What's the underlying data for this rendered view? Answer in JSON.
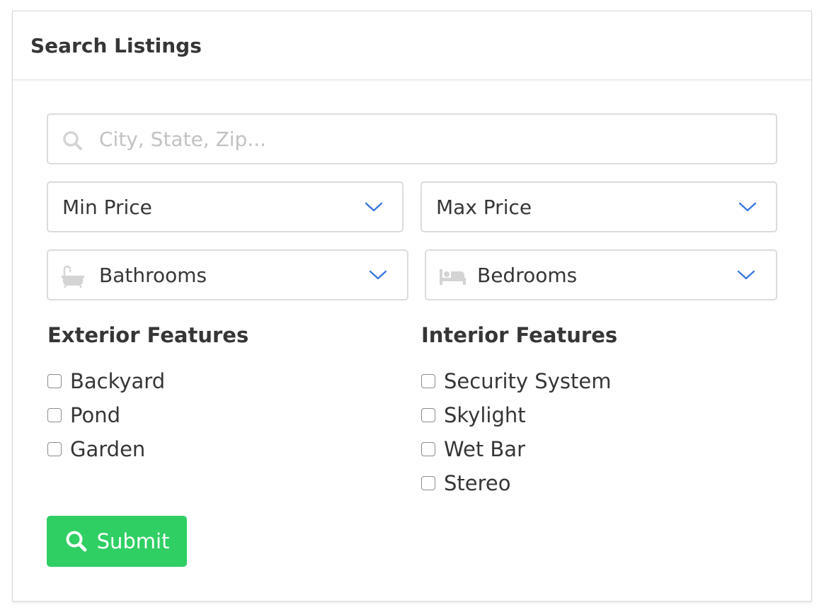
{
  "header": {
    "title": "Search Listings"
  },
  "search": {
    "placeholder": "City, State, Zip...",
    "icon": "search-icon"
  },
  "filters": {
    "min_price": "Min Price",
    "max_price": "Max Price",
    "bathrooms": "Bathrooms",
    "bedrooms": "Bedrooms",
    "bathrooms_icon": "bathtub-icon",
    "bedrooms_icon": "bed-icon",
    "chevron_color": "#3273dc"
  },
  "exterior": {
    "title": "Exterior Features",
    "items": [
      {
        "label": "Backyard",
        "checked": false
      },
      {
        "label": "Pond",
        "checked": false
      },
      {
        "label": "Garden",
        "checked": false
      }
    ]
  },
  "interior": {
    "title": "Interior Features",
    "items": [
      {
        "label": "Security System",
        "checked": false
      },
      {
        "label": "Skylight",
        "checked": false
      },
      {
        "label": "Wet Bar",
        "checked": false
      },
      {
        "label": "Stereo",
        "checked": false
      }
    ]
  },
  "submit": {
    "label": "Submit",
    "color": "#2fcf64",
    "icon": "search-icon"
  }
}
